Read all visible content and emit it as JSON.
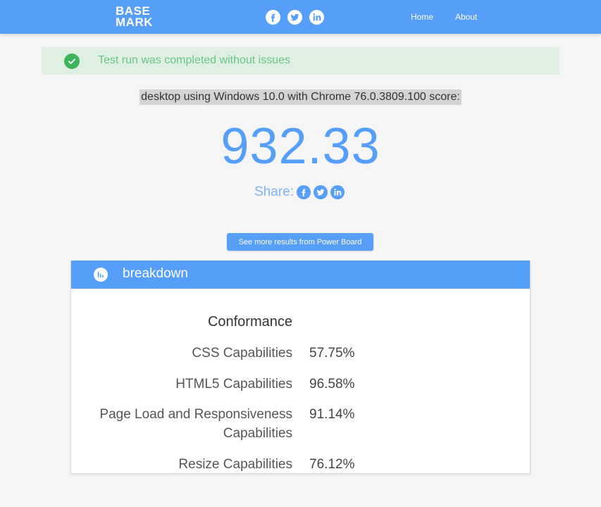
{
  "header": {
    "logo_line1": "BASE",
    "logo_line2": "MARK",
    "social_icons": [
      "facebook-icon",
      "twitter-icon",
      "linkedin-icon"
    ],
    "nav": {
      "home": "Home",
      "about": "About"
    }
  },
  "alert": {
    "message": "Test run was completed without issues",
    "icon": "check-circle-icon",
    "color": "#3cb55b"
  },
  "result": {
    "subtitle": "desktop using Windows 10.0 with Chrome 76.0.3809.100 score:",
    "score": "932.33",
    "share_label": "Share:",
    "more_button": "See more results from Power Board"
  },
  "breakdown": {
    "title": "breakdown",
    "icon": "bar-chart-icon",
    "section": "Conformance",
    "rows": [
      {
        "label": "CSS Capabilities",
        "value": "57.75%"
      },
      {
        "label": "HTML5 Capabilities",
        "value": "96.58%"
      },
      {
        "label": "Page Load and Responsiveness Capabilities",
        "value": "91.14%"
      },
      {
        "label": "Resize Capabilities",
        "value": "76.12%"
      }
    ]
  },
  "colors": {
    "accent": "#559ef9",
    "success_bg": "#dff0e2",
    "success_text": "#6ac382"
  }
}
